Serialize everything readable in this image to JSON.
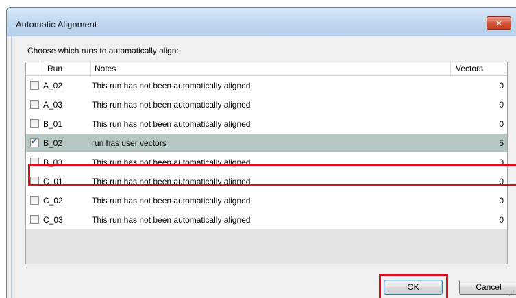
{
  "dialog": {
    "title": "Automatic Alignment",
    "close_icon": "close-icon",
    "prompt": "Choose which runs to automatically align:"
  },
  "table": {
    "headers": {
      "run": "Run",
      "notes": "Notes",
      "vectors": "Vectors"
    },
    "rows": [
      {
        "run": "A_02",
        "notes": "This run has not been automatically aligned",
        "vectors": "0",
        "checked": false
      },
      {
        "run": "A_03",
        "notes": "This run has not been automatically aligned",
        "vectors": "0",
        "checked": false
      },
      {
        "run": "B_01",
        "notes": "This run has not been automatically aligned",
        "vectors": "0",
        "checked": false
      },
      {
        "run": "B_02",
        "notes": "run has user vectors",
        "vectors": "5",
        "checked": true
      },
      {
        "run": "B_03",
        "notes": "This run has not been automatically aligned",
        "vectors": "0",
        "checked": false
      },
      {
        "run": "C_01",
        "notes": "This run has not been automatically aligned",
        "vectors": "0",
        "checked": false
      },
      {
        "run": "C_02",
        "notes": "This run has not been automatically aligned",
        "vectors": "0",
        "checked": false
      },
      {
        "run": "C_03",
        "notes": "This run has not been automatically aligned",
        "vectors": "0",
        "checked": false
      }
    ]
  },
  "buttons": {
    "ok": "OK",
    "cancel": "Cancel"
  },
  "colors": {
    "highlight": "#e00b1c",
    "selected_row": "#b4c7c2"
  }
}
